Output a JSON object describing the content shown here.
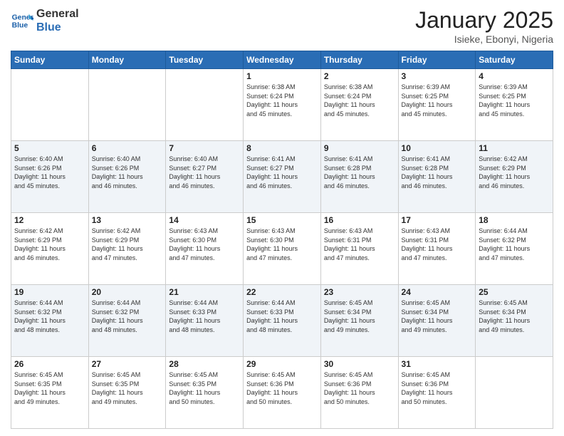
{
  "header": {
    "logo_line1": "General",
    "logo_line2": "Blue",
    "month": "January 2025",
    "location": "Isieke, Ebonyi, Nigeria"
  },
  "weekdays": [
    "Sunday",
    "Monday",
    "Tuesday",
    "Wednesday",
    "Thursday",
    "Friday",
    "Saturday"
  ],
  "weeks": [
    [
      {
        "day": "",
        "info": ""
      },
      {
        "day": "",
        "info": ""
      },
      {
        "day": "",
        "info": ""
      },
      {
        "day": "1",
        "info": "Sunrise: 6:38 AM\nSunset: 6:24 PM\nDaylight: 11 hours\nand 45 minutes."
      },
      {
        "day": "2",
        "info": "Sunrise: 6:38 AM\nSunset: 6:24 PM\nDaylight: 11 hours\nand 45 minutes."
      },
      {
        "day": "3",
        "info": "Sunrise: 6:39 AM\nSunset: 6:25 PM\nDaylight: 11 hours\nand 45 minutes."
      },
      {
        "day": "4",
        "info": "Sunrise: 6:39 AM\nSunset: 6:25 PM\nDaylight: 11 hours\nand 45 minutes."
      }
    ],
    [
      {
        "day": "5",
        "info": "Sunrise: 6:40 AM\nSunset: 6:26 PM\nDaylight: 11 hours\nand 45 minutes."
      },
      {
        "day": "6",
        "info": "Sunrise: 6:40 AM\nSunset: 6:26 PM\nDaylight: 11 hours\nand 46 minutes."
      },
      {
        "day": "7",
        "info": "Sunrise: 6:40 AM\nSunset: 6:27 PM\nDaylight: 11 hours\nand 46 minutes."
      },
      {
        "day": "8",
        "info": "Sunrise: 6:41 AM\nSunset: 6:27 PM\nDaylight: 11 hours\nand 46 minutes."
      },
      {
        "day": "9",
        "info": "Sunrise: 6:41 AM\nSunset: 6:28 PM\nDaylight: 11 hours\nand 46 minutes."
      },
      {
        "day": "10",
        "info": "Sunrise: 6:41 AM\nSunset: 6:28 PM\nDaylight: 11 hours\nand 46 minutes."
      },
      {
        "day": "11",
        "info": "Sunrise: 6:42 AM\nSunset: 6:29 PM\nDaylight: 11 hours\nand 46 minutes."
      }
    ],
    [
      {
        "day": "12",
        "info": "Sunrise: 6:42 AM\nSunset: 6:29 PM\nDaylight: 11 hours\nand 46 minutes."
      },
      {
        "day": "13",
        "info": "Sunrise: 6:42 AM\nSunset: 6:29 PM\nDaylight: 11 hours\nand 47 minutes."
      },
      {
        "day": "14",
        "info": "Sunrise: 6:43 AM\nSunset: 6:30 PM\nDaylight: 11 hours\nand 47 minutes."
      },
      {
        "day": "15",
        "info": "Sunrise: 6:43 AM\nSunset: 6:30 PM\nDaylight: 11 hours\nand 47 minutes."
      },
      {
        "day": "16",
        "info": "Sunrise: 6:43 AM\nSunset: 6:31 PM\nDaylight: 11 hours\nand 47 minutes."
      },
      {
        "day": "17",
        "info": "Sunrise: 6:43 AM\nSunset: 6:31 PM\nDaylight: 11 hours\nand 47 minutes."
      },
      {
        "day": "18",
        "info": "Sunrise: 6:44 AM\nSunset: 6:32 PM\nDaylight: 11 hours\nand 47 minutes."
      }
    ],
    [
      {
        "day": "19",
        "info": "Sunrise: 6:44 AM\nSunset: 6:32 PM\nDaylight: 11 hours\nand 48 minutes."
      },
      {
        "day": "20",
        "info": "Sunrise: 6:44 AM\nSunset: 6:32 PM\nDaylight: 11 hours\nand 48 minutes."
      },
      {
        "day": "21",
        "info": "Sunrise: 6:44 AM\nSunset: 6:33 PM\nDaylight: 11 hours\nand 48 minutes."
      },
      {
        "day": "22",
        "info": "Sunrise: 6:44 AM\nSunset: 6:33 PM\nDaylight: 11 hours\nand 48 minutes."
      },
      {
        "day": "23",
        "info": "Sunrise: 6:45 AM\nSunset: 6:34 PM\nDaylight: 11 hours\nand 49 minutes."
      },
      {
        "day": "24",
        "info": "Sunrise: 6:45 AM\nSunset: 6:34 PM\nDaylight: 11 hours\nand 49 minutes."
      },
      {
        "day": "25",
        "info": "Sunrise: 6:45 AM\nSunset: 6:34 PM\nDaylight: 11 hours\nand 49 minutes."
      }
    ],
    [
      {
        "day": "26",
        "info": "Sunrise: 6:45 AM\nSunset: 6:35 PM\nDaylight: 11 hours\nand 49 minutes."
      },
      {
        "day": "27",
        "info": "Sunrise: 6:45 AM\nSunset: 6:35 PM\nDaylight: 11 hours\nand 49 minutes."
      },
      {
        "day": "28",
        "info": "Sunrise: 6:45 AM\nSunset: 6:35 PM\nDaylight: 11 hours\nand 50 minutes."
      },
      {
        "day": "29",
        "info": "Sunrise: 6:45 AM\nSunset: 6:36 PM\nDaylight: 11 hours\nand 50 minutes."
      },
      {
        "day": "30",
        "info": "Sunrise: 6:45 AM\nSunset: 6:36 PM\nDaylight: 11 hours\nand 50 minutes."
      },
      {
        "day": "31",
        "info": "Sunrise: 6:45 AM\nSunset: 6:36 PM\nDaylight: 11 hours\nand 50 minutes."
      },
      {
        "day": "",
        "info": ""
      }
    ]
  ]
}
